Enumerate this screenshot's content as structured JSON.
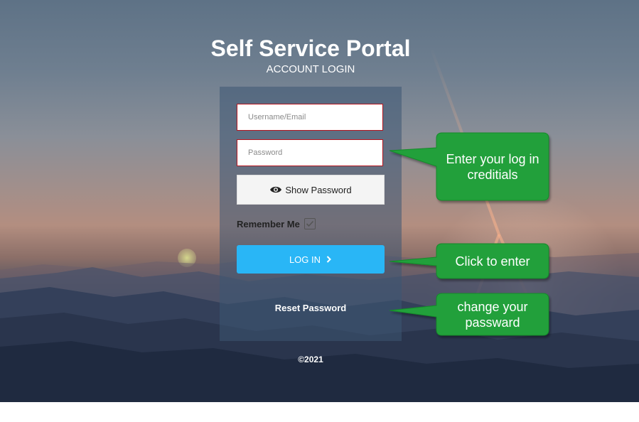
{
  "header": {
    "title": "Self Service Portal",
    "subtitle": "ACCOUNT LOGIN"
  },
  "form": {
    "username_placeholder": "Username/Email",
    "password_placeholder": "Password",
    "show_password_label": "Show Password",
    "remember_me_label": "Remember Me",
    "remember_me_checked": true,
    "login_label": "LOG IN",
    "reset_label": "Reset Password"
  },
  "footer": {
    "copyright": "©2021"
  },
  "callouts": [
    {
      "text_line1": "Enter your log in",
      "text_line2": "creditials"
    },
    {
      "text_line1": "Click to enter"
    },
    {
      "text_line1": "change your",
      "text_line2": "passward"
    }
  ],
  "colors": {
    "login_button": "#29b6f6",
    "field_border": "#b4141e",
    "callout_fill": "#21a03a"
  },
  "icons": {
    "show_password": "eye-icon",
    "remember": "checkbox-check-icon",
    "login": "chevron-right-icon"
  }
}
